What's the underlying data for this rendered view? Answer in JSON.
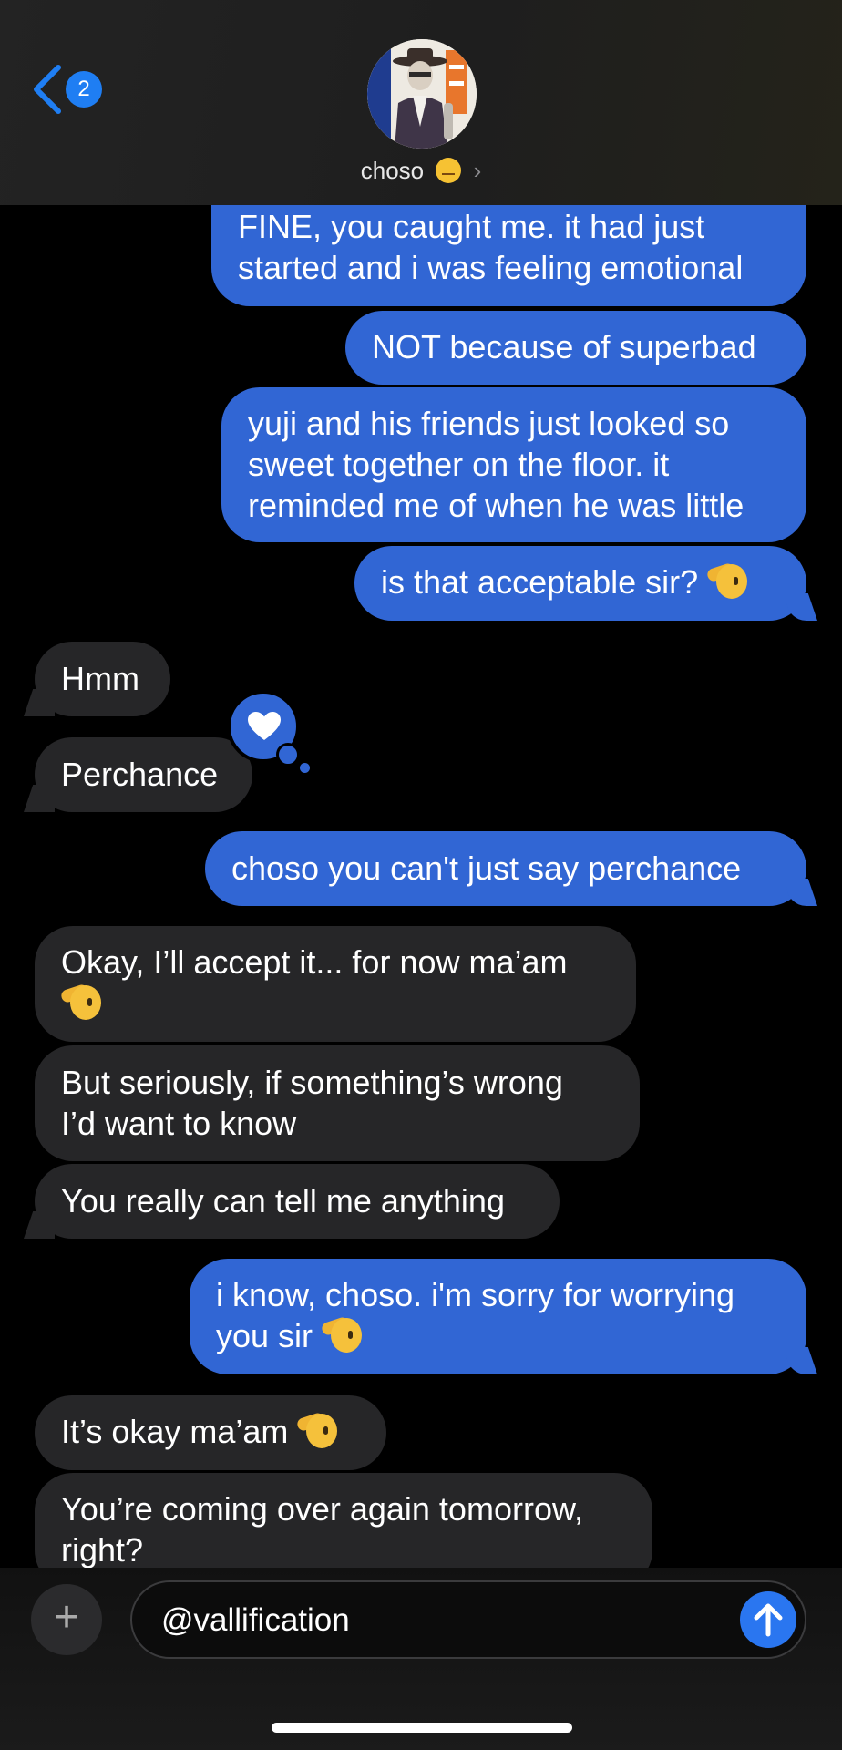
{
  "header": {
    "back_badge_count": "2",
    "contact_name": "choso",
    "contact_emoji_icon": "pensive-face-icon",
    "chevron": "›"
  },
  "messages": [
    {
      "from": "me",
      "lines": [
        "FINE, you caught me. it had just",
        "started and i was feeling emotional"
      ]
    },
    {
      "from": "me",
      "lines": [
        "NOT because of superbad"
      ]
    },
    {
      "from": "me",
      "lines": [
        "yuji and his friends just looked so",
        "sweet together on the floor. it",
        "reminded me of when he was little"
      ]
    },
    {
      "from": "me",
      "lines": [
        "is that acceptable sir?"
      ],
      "emoji": "saluting-face"
    },
    {
      "from": "them",
      "lines": [
        "Hmm"
      ]
    },
    {
      "from": "them",
      "lines": [
        "Perchance"
      ],
      "reaction": "heart"
    },
    {
      "from": "me",
      "lines": [
        "choso you can't just say perchance"
      ]
    },
    {
      "from": "them",
      "lines": [
        "Okay, I’ll accept it... for now ma’am"
      ],
      "emoji": "saluting-face"
    },
    {
      "from": "them",
      "lines": [
        "But seriously, if something’s wrong",
        "I’d want to know"
      ]
    },
    {
      "from": "them",
      "lines": [
        "You really can tell me anything"
      ]
    },
    {
      "from": "me",
      "lines": [
        "i know, choso. i'm sorry for worrying",
        "you sir"
      ],
      "emoji": "saluting-face"
    },
    {
      "from": "them",
      "lines": [
        "It’s okay ma’am"
      ],
      "emoji": "saluting-face"
    },
    {
      "from": "them",
      "lines": [
        "You’re coming over again tomorrow,",
        "right?"
      ]
    }
  ],
  "composer": {
    "plus_label": "+",
    "input_value": "@vallification"
  },
  "colors": {
    "outgoing_bubble": "#3166d4",
    "incoming_bubble": "#262628",
    "accent": "#1f7ef3"
  }
}
